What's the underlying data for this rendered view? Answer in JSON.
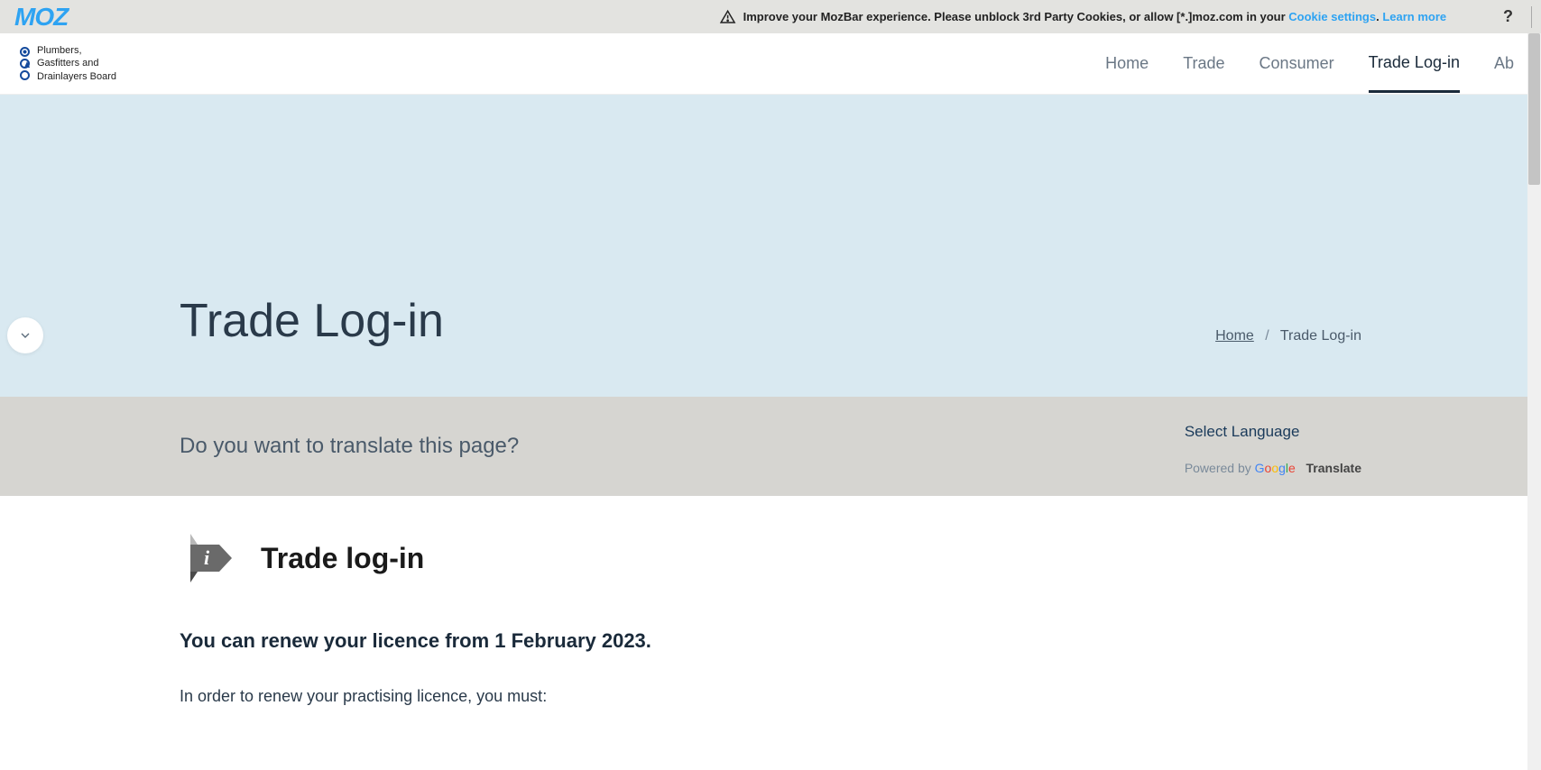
{
  "mozbar": {
    "logo": "MOZ",
    "message": "Improve your MozBar experience. Please unblock 3rd Party Cookies, or allow [*.]moz.com in your ",
    "cookie_link": "Cookie settings",
    "period": ". ",
    "learn_link": "Learn more",
    "help": "?"
  },
  "header": {
    "logo_lines": [
      "Plumbers,",
      "Gasfitters and",
      "Drainlayers Board"
    ],
    "nav": {
      "home": "Home",
      "trade": "Trade",
      "consumer": "Consumer",
      "login": "Trade Log-in",
      "about": "Ab"
    }
  },
  "hero": {
    "title": "Trade Log-in",
    "breadcrumb_home": "Home",
    "breadcrumb_sep": "/",
    "breadcrumb_current": "Trade Log-in"
  },
  "translate": {
    "question": "Do you want to translate this page?",
    "select": "Select Language",
    "powered": "Powered by ",
    "google": "Google",
    "translate_word": "Translate"
  },
  "content": {
    "section_title": "Trade log-in",
    "lead": "You can renew your licence from 1 February 2023.",
    "para1": "In order to renew your practising licence, you must:"
  }
}
